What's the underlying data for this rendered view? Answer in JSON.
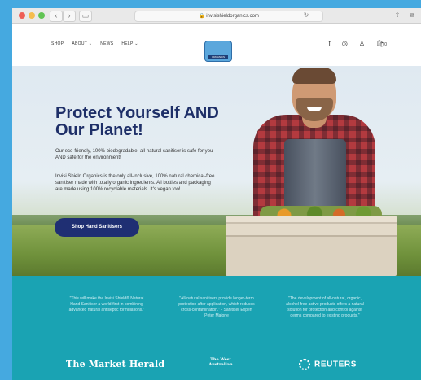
{
  "browser": {
    "url": "invisishieldorganics.com",
    "reload_icon": "reload-icon",
    "share_icon": "share-icon",
    "tabs_icon": "tabs-icon"
  },
  "nav": {
    "links": [
      {
        "label": "SHOP"
      },
      {
        "label": "ABOUT ⌄"
      },
      {
        "label": "NEWS"
      },
      {
        "label": "HELP ⌄"
      }
    ],
    "logo_text": "ORGANICS",
    "icons": [
      "facebook-icon",
      "instagram-icon",
      "account-icon",
      "cart-icon"
    ],
    "cart_count": "0"
  },
  "hero": {
    "title": "Protect Yourself AND Our Planet!",
    "para1": "Our eco-friendly, 100% biodegradable, all-natural sanitiser is safe for you AND safe for the environment!",
    "para2": "Invisi Shield Organics is the only all-inclusive, 100% natural chemical-free sanitiser made with totally organic ingredients. All bottles and packaging are made using 100% recyclable materials. It's vegan too!",
    "cta_label": "Shop Hand Sanitisers"
  },
  "press": {
    "quotes": [
      "\"This will make the Invisi Shield® Natural Hand Sanitiser a world-first in combining advanced natural antiseptic formulations.\"",
      "\"All-natural sanitisers provide longer-term protection after application, which reduces cross-contamination.\" - Sanitiser Expert Peter Malone",
      "\"The development of all-natural, organic, alcohol-free active products offers a natural solution for protection and control against germs compared to existing products.\""
    ],
    "publications": [
      "The Market Herald",
      "The West Australian",
      "REUTERS"
    ]
  },
  "colors": {
    "background": "#45a9e0",
    "navy": "#1f2f73",
    "teal": "#1aa3b3"
  }
}
